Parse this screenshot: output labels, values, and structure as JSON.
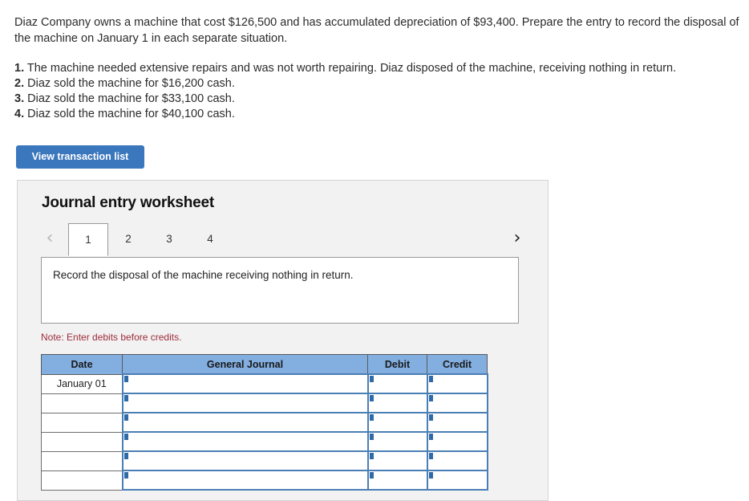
{
  "problem": {
    "intro": "Diaz Company owns a machine that cost $126,500 and has accumulated depreciation of $93,400. Prepare the entry to record the disposal of the machine on January 1 in each separate situation.",
    "situations": [
      {
        "num": "1.",
        "text": "The machine needed extensive repairs and was not worth repairing. Diaz disposed of the machine, receiving nothing in return."
      },
      {
        "num": "2.",
        "text": "Diaz sold the machine for $16,200 cash."
      },
      {
        "num": "3.",
        "text": "Diaz sold the machine for $33,100 cash."
      },
      {
        "num": "4.",
        "text": "Diaz sold the machine for $40,100 cash."
      }
    ]
  },
  "toolbar": {
    "view_transaction_list_label": "View transaction list"
  },
  "worksheet": {
    "title": "Journal entry worksheet",
    "prev_icon": "‹",
    "next_icon": "›",
    "tabs": [
      {
        "label": "1",
        "active": true
      },
      {
        "label": "2",
        "active": false
      },
      {
        "label": "3",
        "active": false
      },
      {
        "label": "4",
        "active": false
      }
    ],
    "description": "Record the disposal of the machine receiving nothing in return.",
    "note": "Note: Enter debits before credits.",
    "table": {
      "headers": [
        "Date",
        "General Journal",
        "Debit",
        "Credit"
      ],
      "rows": [
        {
          "date": "January 01",
          "journal": "",
          "debit": "",
          "credit": ""
        },
        {
          "date": "",
          "journal": "",
          "debit": "",
          "credit": ""
        },
        {
          "date": "",
          "journal": "",
          "debit": "",
          "credit": ""
        },
        {
          "date": "",
          "journal": "",
          "debit": "",
          "credit": ""
        },
        {
          "date": "",
          "journal": "",
          "debit": "",
          "credit": ""
        },
        {
          "date": "",
          "journal": "",
          "debit": "",
          "credit": ""
        }
      ]
    }
  },
  "colors": {
    "button_blue": "#3b77bd",
    "header_blue": "#82aee0",
    "cell_border_blue": "#4a7fb5",
    "note_red": "#9e2b3a",
    "panel_bg": "#f2f2f2"
  }
}
